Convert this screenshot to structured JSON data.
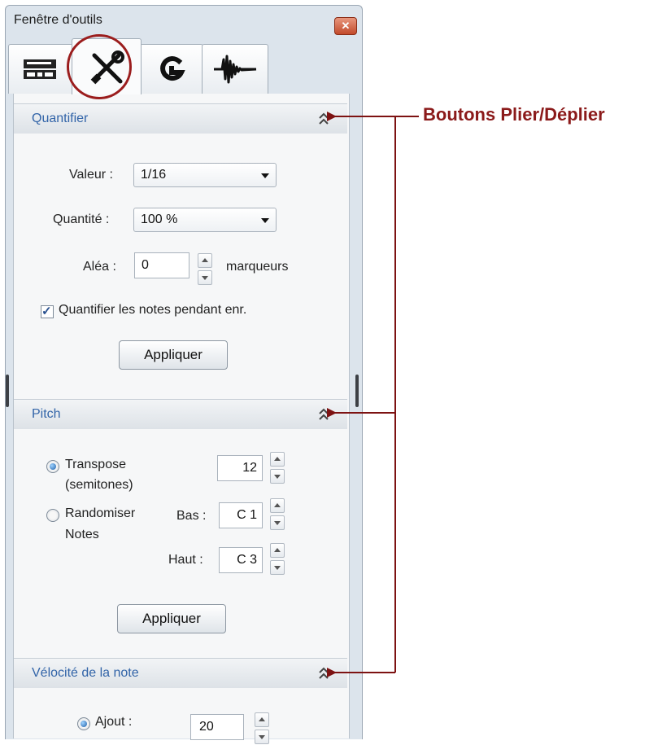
{
  "window": {
    "title": "Fenêtre d'outils",
    "close_glyph": "✕"
  },
  "tabs": [
    {
      "icon": "mixer-icon"
    },
    {
      "icon": "tools-icon",
      "active": true
    },
    {
      "icon": "groove-icon"
    },
    {
      "icon": "waveform-icon"
    }
  ],
  "quantize": {
    "title": "Quantifier",
    "value_label": "Valeur :",
    "value": "1/16",
    "quantity_label": "Quantité :",
    "quantity": "100 %",
    "random_label": "Aléa :",
    "random_value": "0",
    "random_unit": "marqueurs",
    "record_checkbox_label": "Quantifier les notes pendant enr.",
    "record_checked": true,
    "apply_label": "Appliquer"
  },
  "pitch": {
    "title": "Pitch",
    "transpose_label_1": "Transpose",
    "transpose_label_2": "(semitones)",
    "transpose_value": "12",
    "randomize_label_1": "Randomiser",
    "randomize_label_2": "Notes",
    "low_label": "Bas :",
    "low_value": "C 1",
    "high_label": "Haut :",
    "high_value": "C 3",
    "apply_label": "Appliquer"
  },
  "velocity": {
    "title": "Vélocité de la note",
    "add_label": "Ajout :",
    "add_value": "20"
  },
  "annotation": {
    "text": "Boutons Plier/Déplier",
    "color": "#8b1a1a"
  }
}
